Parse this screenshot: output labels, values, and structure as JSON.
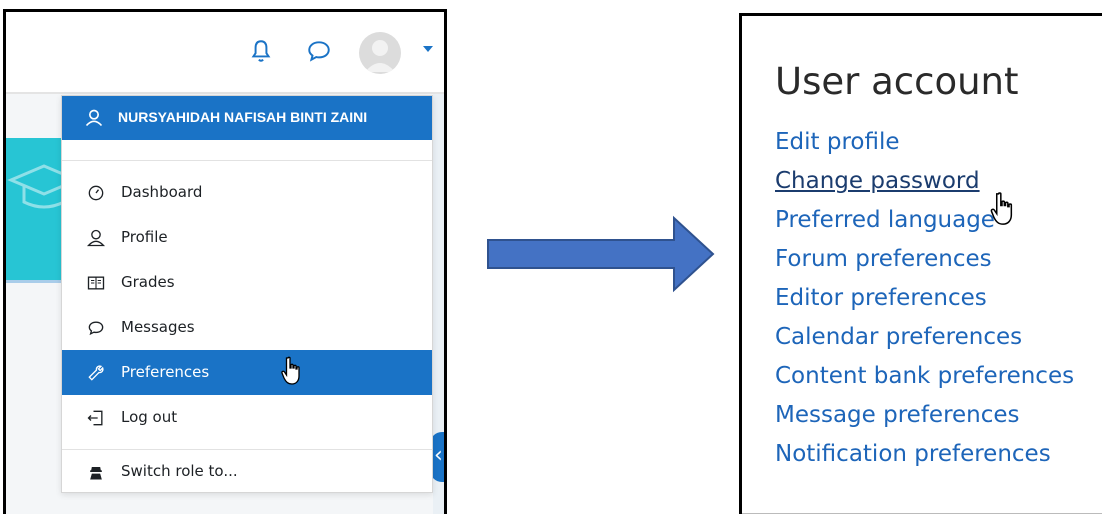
{
  "user_menu": {
    "user_name": "NURSYAHIDAH NAFISAH BINTI ZAINI",
    "items": [
      {
        "label": "Dashboard",
        "icon": "dashboard-gauge-icon"
      },
      {
        "label": "Profile",
        "icon": "user-icon"
      },
      {
        "label": "Grades",
        "icon": "grades-book-icon"
      },
      {
        "label": "Messages",
        "icon": "chat-bubble-icon"
      },
      {
        "label": "Preferences",
        "icon": "wrench-icon",
        "active": true
      },
      {
        "label": "Log out",
        "icon": "logout-icon"
      }
    ],
    "switch_role_label": "Switch role to..."
  },
  "user_account": {
    "title": "User account",
    "links": [
      "Edit profile",
      "Change password",
      "Preferred language",
      "Forum preferences",
      "Editor preferences",
      "Calendar preferences",
      "Content bank preferences",
      "Message preferences",
      "Notification preferences"
    ]
  },
  "colors": {
    "primary": "#1a73c6",
    "link": "#1d65b9",
    "teal": "#27c5d4"
  }
}
